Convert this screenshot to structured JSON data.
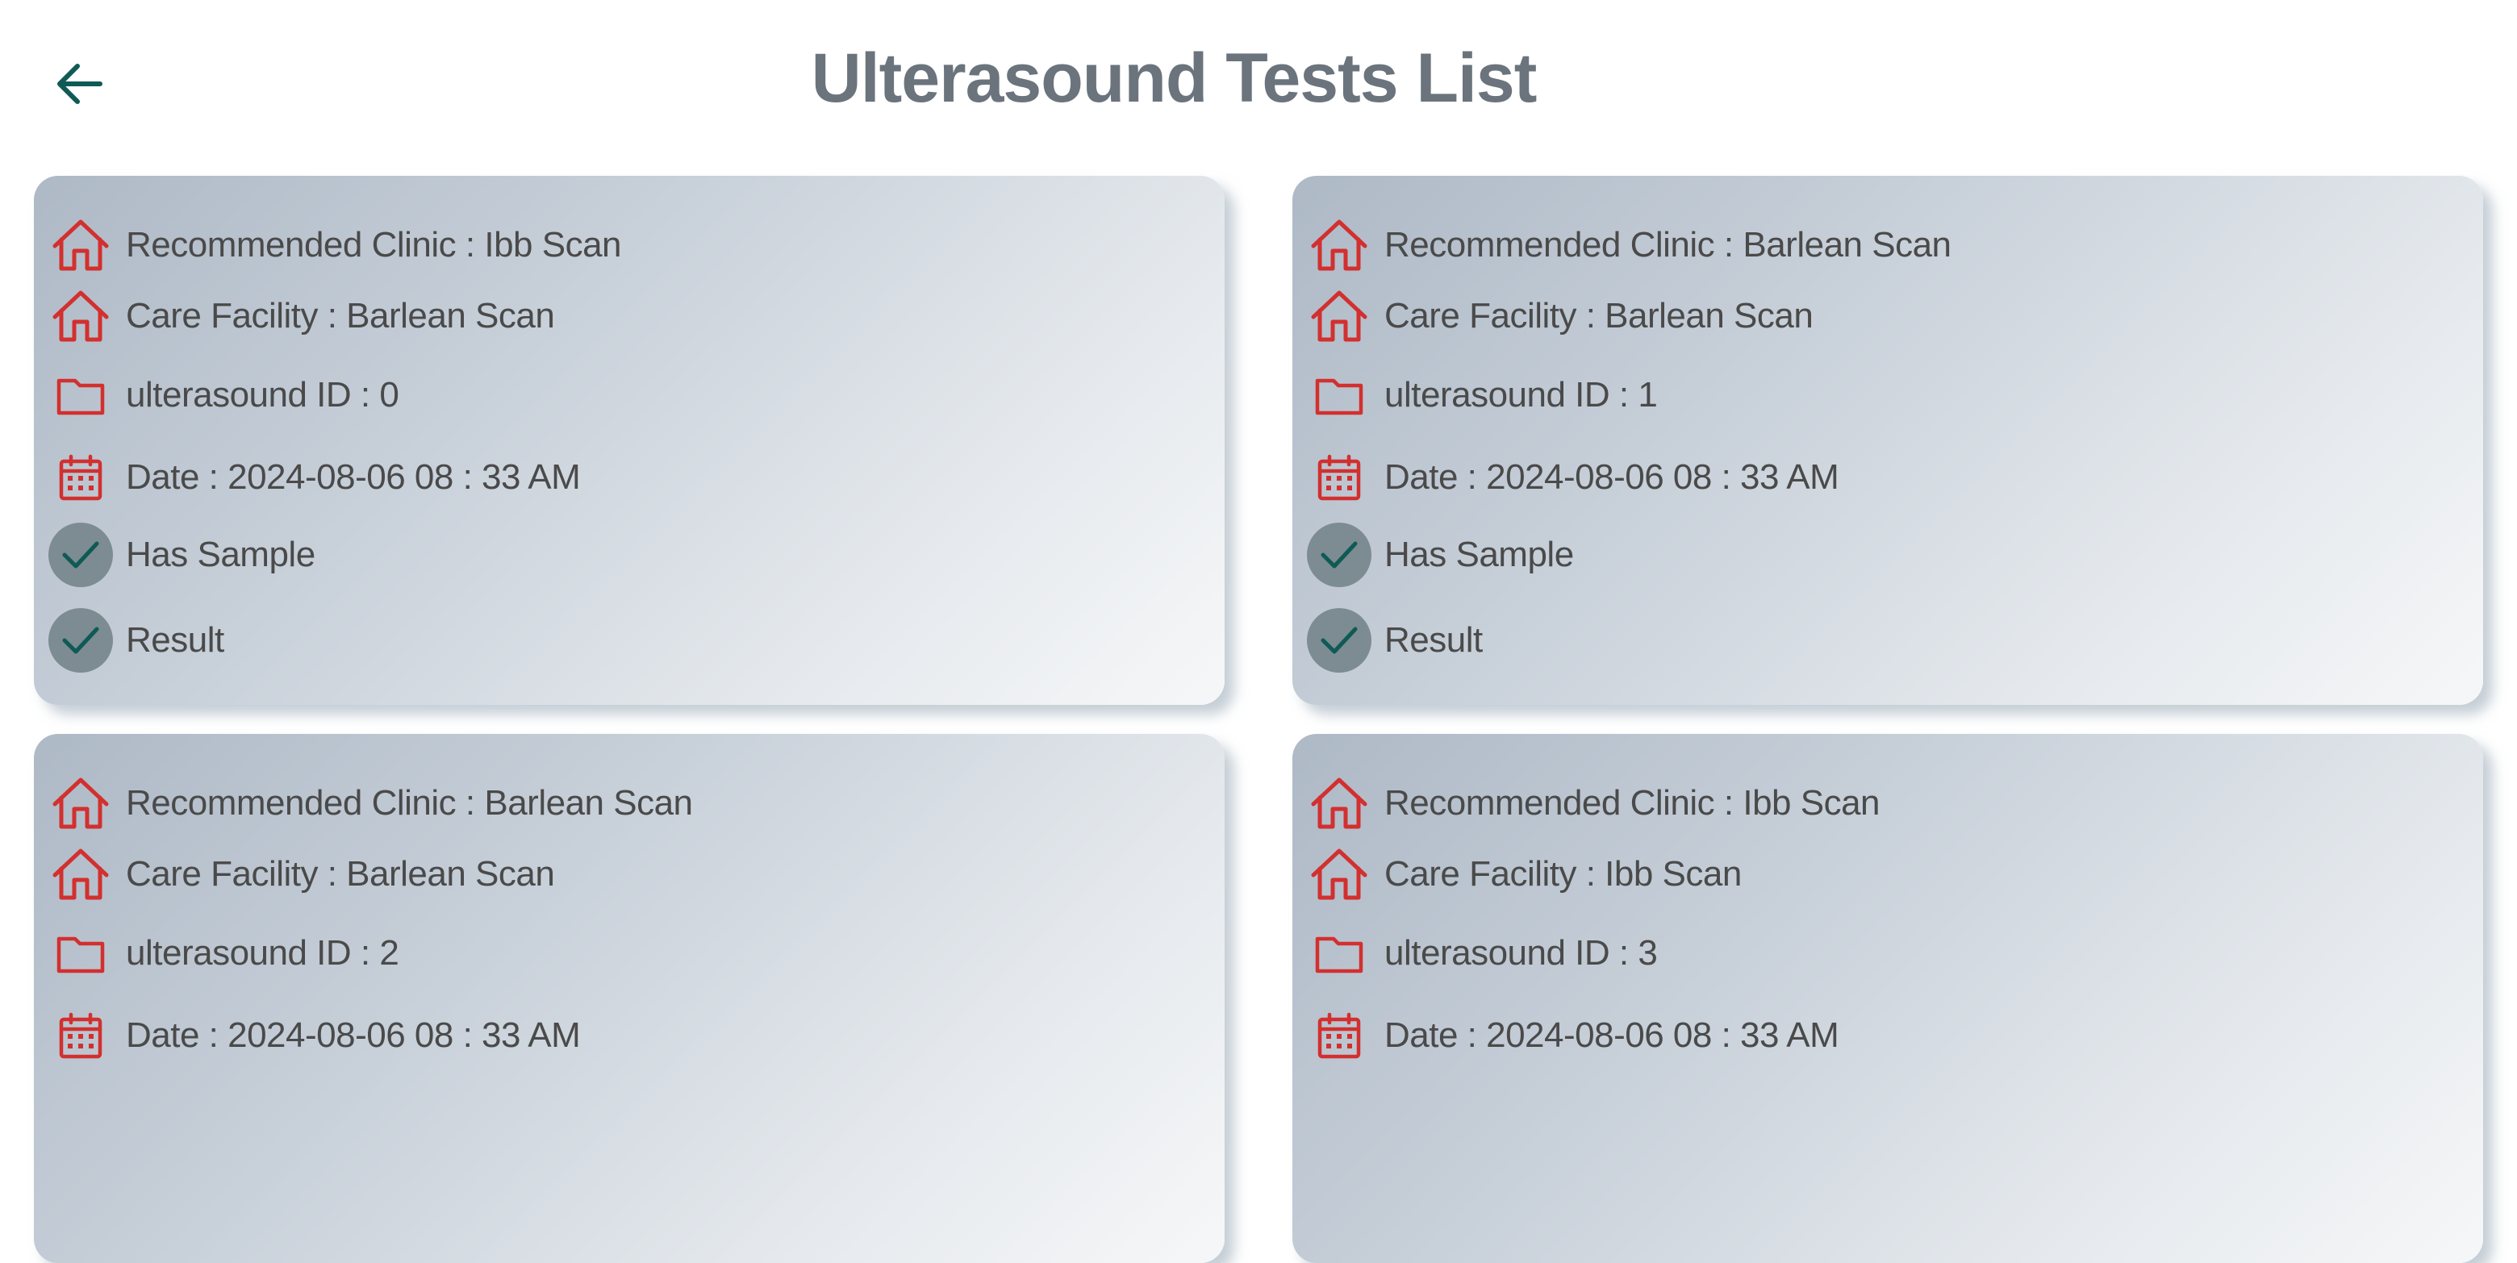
{
  "header": {
    "title": "Ulterasound Tests List",
    "back_icon": "arrow-left-icon"
  },
  "colors": {
    "icon_red": "#d2302f",
    "accent_teal": "#0f5a55",
    "title_gray": "#6b747c",
    "check_bg": "#7d8b92"
  },
  "cards": [
    {
      "clinic": "Recommended Clinic : Ibb Scan",
      "facility": "Care Facility : Barlean Scan",
      "ulterasound_id": "ulterasound ID : 0",
      "date": "Date : 2024-08-06  08 : 33 AM",
      "has_sample": "Has Sample",
      "result": "Result"
    },
    {
      "clinic": "Recommended Clinic : Barlean Scan",
      "facility": "Care Facility : Barlean Scan",
      "ulterasound_id": "ulterasound ID : 1",
      "date": "Date : 2024-08-06  08 : 33 AM",
      "has_sample": "Has Sample",
      "result": "Result"
    },
    {
      "clinic": "Recommended Clinic : Barlean Scan",
      "facility": "Care Facility : Barlean Scan",
      "ulterasound_id": "ulterasound ID : 2",
      "date": "Date : 2024-08-06  08 : 33 AM"
    },
    {
      "clinic": "Recommended Clinic : Ibb Scan",
      "facility": "Care Facility : Ibb Scan",
      "ulterasound_id": "ulterasound ID : 3",
      "date": "Date : 2024-08-06  08 : 33 AM"
    }
  ]
}
